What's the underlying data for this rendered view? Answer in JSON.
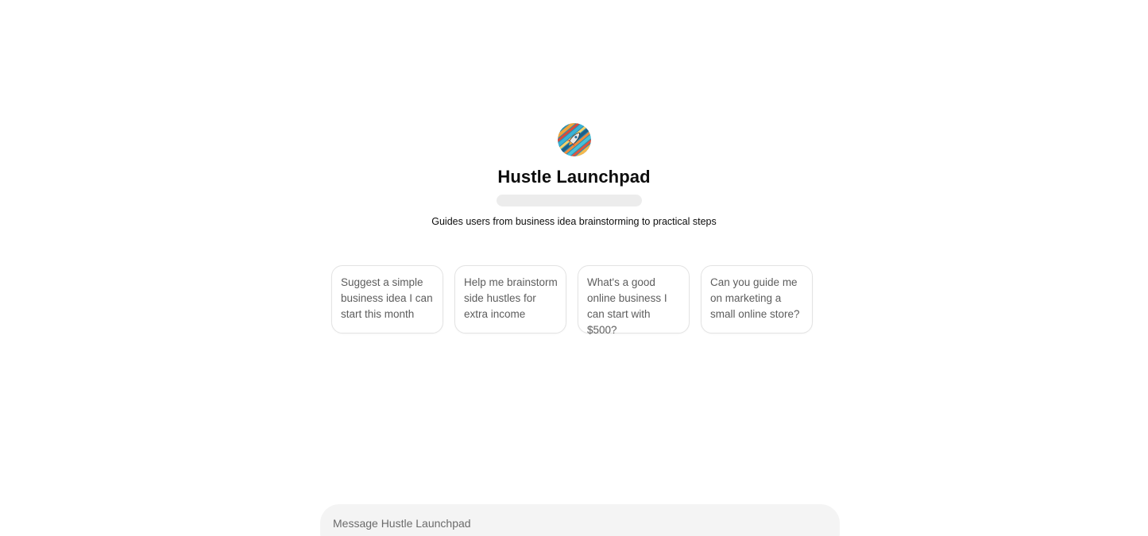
{
  "gpt": {
    "name": "Hustle Launchpad",
    "description": "Guides users from business idea brainstorming to practical steps",
    "avatar_icon": "rocket-icon"
  },
  "starters": [
    {
      "label": "Suggest a simple business idea I can start this month"
    },
    {
      "label": "Help me brainstorm side hustles for extra income"
    },
    {
      "label": "What's a good online business I can start with $500?"
    },
    {
      "label": "Can you guide me on marketing a small online store?"
    }
  ],
  "composer": {
    "placeholder": "Message Hustle Launchpad"
  },
  "colors": {
    "card_border": "#e3e3e3",
    "composer_bg": "#f4f4f4",
    "muted_text": "#5d5d5d"
  }
}
